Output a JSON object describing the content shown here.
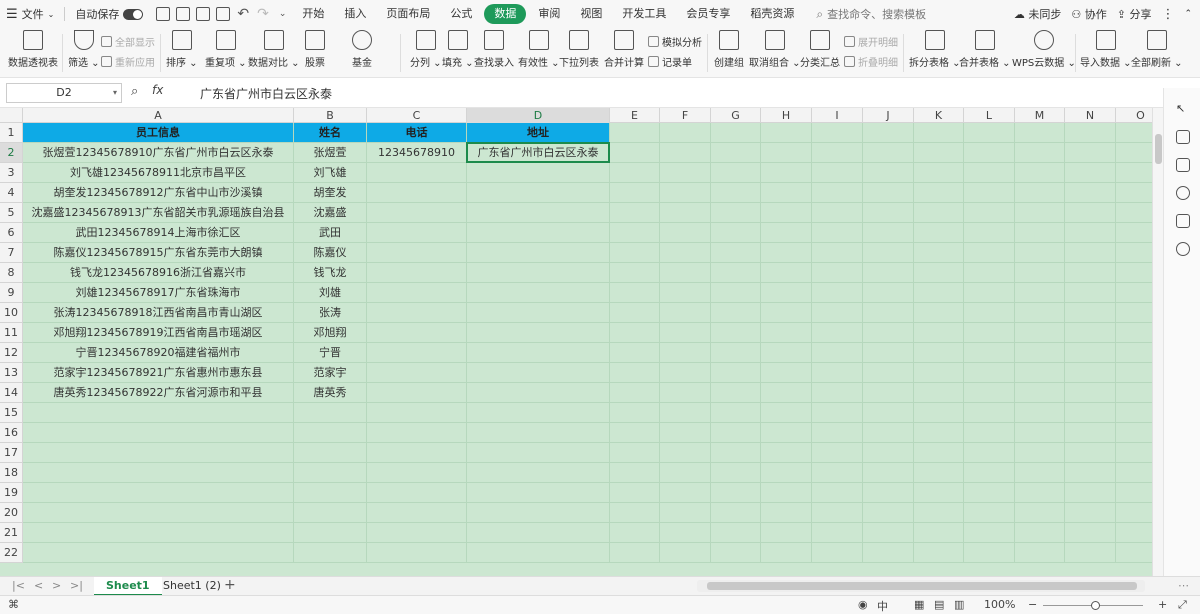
{
  "menu": {
    "file": "文件",
    "autosave": "自动保存",
    "tabs": [
      "开始",
      "插入",
      "页面布局",
      "公式",
      "数据",
      "审阅",
      "视图",
      "开发工具",
      "会员专享",
      "稻壳资源"
    ],
    "active_tab": "数据",
    "search": "查找命令、搜索模板",
    "sync": "未同步",
    "collab": "协作",
    "share": "分享"
  },
  "ribbon": {
    "pivot": "数据透视表",
    "filter": "筛选",
    "show_all": "全部显示",
    "reapply": "重新应用",
    "sort": "排序",
    "duplicates": "重复项",
    "compare": "数据对比",
    "stock": "股票",
    "fund": "基金",
    "split_col": "分列",
    "fill": "填充",
    "lookup": "查找录入",
    "validity": "有效性",
    "dropdown": "下拉列表",
    "consolidate": "合并计算",
    "simulate": "模拟分析",
    "record": "记录单",
    "create_group": "创建组",
    "ungroup": "取消组合",
    "subtotal": "分类汇总",
    "expand": "展开明细",
    "collapse": "折叠明细",
    "split_table": "拆分表格",
    "merge_table": "合并表格",
    "wps_cloud": "WPS云数据",
    "import": "导入数据",
    "refresh_all": "全部刷新"
  },
  "formula_bar": {
    "cell_ref": "D2",
    "fx": "fx",
    "content": "广东省广州市白云区永泰"
  },
  "columns": [
    "A",
    "B",
    "C",
    "D",
    "E",
    "F",
    "G",
    "H",
    "I",
    "J",
    "K",
    "L",
    "M",
    "N",
    "O"
  ],
  "row_numbers": [
    "1",
    "2",
    "3",
    "4",
    "5",
    "6",
    "7",
    "8",
    "9",
    "10",
    "11",
    "12",
    "13",
    "14",
    "15",
    "16",
    "17",
    "18",
    "19",
    "20",
    "21",
    "22"
  ],
  "table": {
    "headers": [
      "员工信息",
      "姓名",
      "电话",
      "地址"
    ],
    "rows": [
      [
        "张煜萱12345678910广东省广州市白云区永泰",
        "张煜萱",
        "12345678910",
        "广东省广州市白云区永泰"
      ],
      [
        "刘飞雄12345678911北京市昌平区",
        "刘飞雄",
        "",
        ""
      ],
      [
        "胡奎发12345678912广东省中山市沙溪镇",
        "胡奎发",
        "",
        ""
      ],
      [
        "沈嘉盛12345678913广东省韶关市乳源瑶族自治县",
        "沈嘉盛",
        "",
        ""
      ],
      [
        "武田12345678914上海市徐汇区",
        "武田",
        "",
        ""
      ],
      [
        "陈嘉仪12345678915广东省东莞市大朗镇",
        "陈嘉仪",
        "",
        ""
      ],
      [
        "钱飞龙12345678916浙江省嘉兴市",
        "钱飞龙",
        "",
        ""
      ],
      [
        "刘雄12345678917广东省珠海市",
        "刘雄",
        "",
        ""
      ],
      [
        "张涛12345678918江西省南昌市青山湖区",
        "张涛",
        "",
        ""
      ],
      [
        "邓旭翔12345678919江西省南昌市瑶湖区",
        "邓旭翔",
        "",
        ""
      ],
      [
        "宁晋12345678920福建省福州市",
        "宁晋",
        "",
        ""
      ],
      [
        "范家宇12345678921广东省惠州市惠东县",
        "范家宇",
        "",
        ""
      ],
      [
        "唐英秀12345678922广东省河源市和平县",
        "唐英秀",
        "",
        ""
      ]
    ]
  },
  "sheet_tabs": [
    "Sheet1",
    "Sheet1 (2)"
  ],
  "active_sheet": "Sheet1",
  "add_sheet": "+",
  "status": {
    "zoom": "100%",
    "view_mode": "中"
  },
  "colors": {
    "accent": "#1e9a5a",
    "header_fill": "#0eaae6",
    "sheet_bg": "#cce7d1"
  }
}
